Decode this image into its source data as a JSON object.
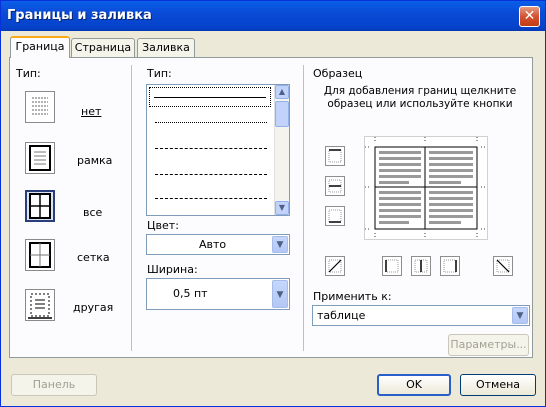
{
  "window": {
    "title": "Границы и заливка",
    "close_symbol": "✕"
  },
  "tabs": [
    {
      "label": "Граница",
      "active": true
    },
    {
      "label": "Страница",
      "active": false
    },
    {
      "label": "Заливка",
      "active": false
    }
  ],
  "type_section": {
    "label": "Тип:",
    "options": [
      {
        "label": "нет",
        "icon": "border-none-icon",
        "selected": false
      },
      {
        "label": "рамка",
        "icon": "border-box-icon",
        "selected": false
      },
      {
        "label": "все",
        "icon": "border-all-icon",
        "selected": true
      },
      {
        "label": "сетка",
        "icon": "border-grid-icon",
        "selected": false
      },
      {
        "label": "другая",
        "icon": "border-custom-icon",
        "selected": false
      }
    ]
  },
  "style_section": {
    "label": "Тип:",
    "styles": [
      "solid",
      "dotted",
      "dashed-fine",
      "dashed",
      "dash-long"
    ],
    "color_label": "Цвет:",
    "color_value": "Авто",
    "width_label": "Ширина:",
    "width_value": "0,5 пт"
  },
  "preview_section": {
    "label": "Образец",
    "hint": "Для добавления границ щелкните образец или используйте кнопки",
    "apply_label": "Применить к:",
    "apply_value": "таблице",
    "options_button": "Параметры..."
  },
  "footer": {
    "panel_button": "Панель",
    "ok_button": "OK",
    "cancel_button": "Отмена"
  },
  "colors": {
    "title_bar": "#0a4bd6",
    "dialog_bg": "#ece9d8",
    "active_tab_accent": "#f9a919"
  }
}
